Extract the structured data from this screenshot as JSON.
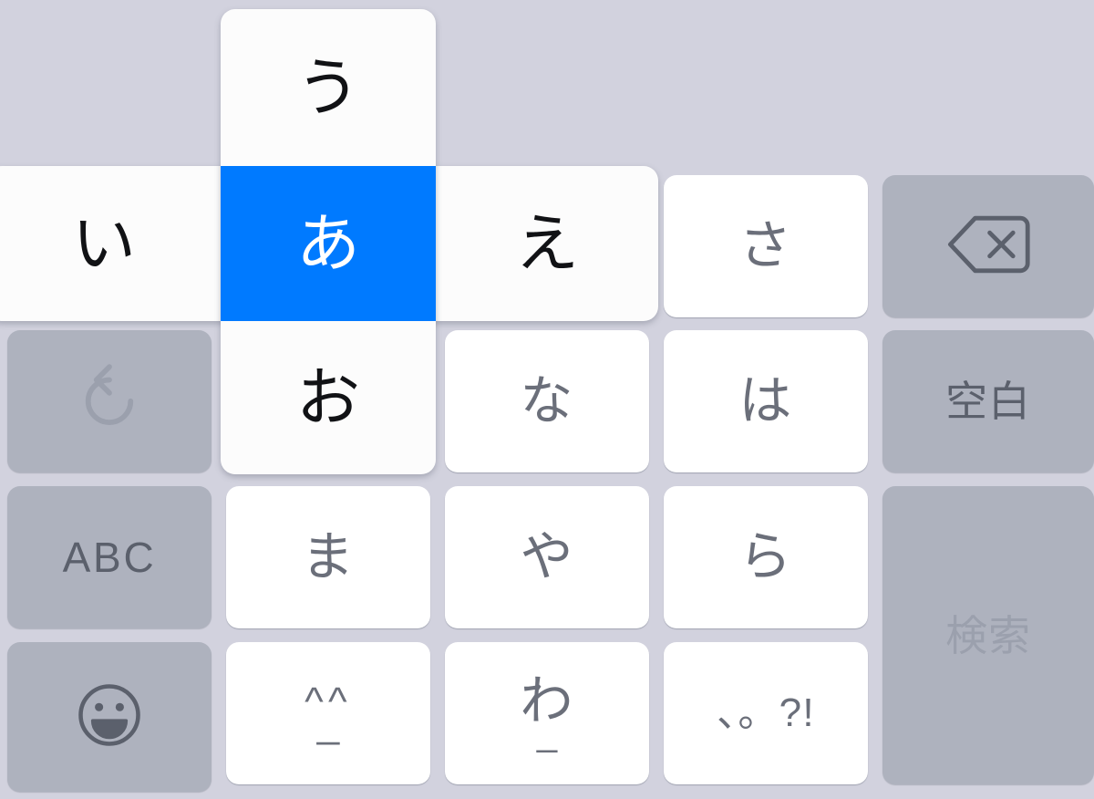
{
  "keyboard": {
    "type": "japanese-kana-flick-keyboard",
    "colors": {
      "background": "#d2d2de",
      "light_key": "#ffffff",
      "dark_key": "#aeb2be",
      "highlight": "#007aff",
      "label": "#6b6f7a",
      "label_dark_key": "#5b606c",
      "label_disabled": "#9ba0ad",
      "flick_popup": "#fcfcfc",
      "flick_label": "#111215",
      "flick_selected_label": "#ffffff"
    },
    "flick_popup": {
      "base_kana": "あ",
      "selected": "あ",
      "up": "う",
      "left": "い",
      "right": "え",
      "down": "お",
      "center_label": "あ"
    },
    "keys": {
      "undo": {
        "icon": "undo-icon",
        "label": ""
      },
      "abc": {
        "label": "ABC"
      },
      "emoji": {
        "icon": "smiley-face-icon",
        "label": ""
      },
      "na": {
        "label": "な"
      },
      "ma": {
        "label": "ま"
      },
      "kaomoji": {
        "carets": "^^",
        "bar": "_"
      },
      "ya": {
        "label": "や"
      },
      "wa": {
        "label": "わ",
        "under": "_"
      },
      "sa": {
        "label": "さ"
      },
      "ha": {
        "label": "は"
      },
      "ra": {
        "label": "ら"
      },
      "punctuation": {
        "label": "、。?!"
      },
      "delete": {
        "icon": "backspace-icon",
        "label": ""
      },
      "space": {
        "label": "空白"
      },
      "search": {
        "label": "検索"
      }
    }
  }
}
